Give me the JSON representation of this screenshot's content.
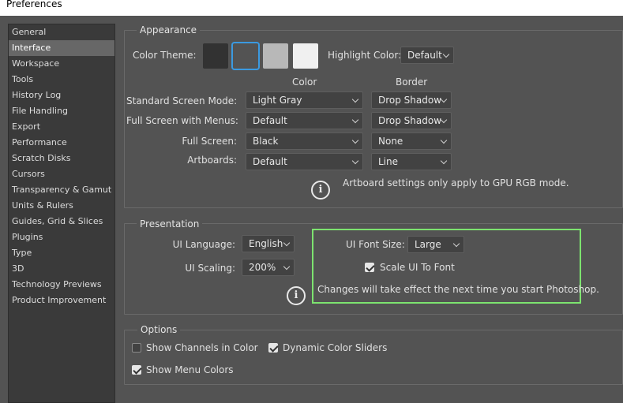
{
  "window": {
    "title": "Preferences"
  },
  "sidebar": {
    "items": [
      {
        "label": "General"
      },
      {
        "label": "Interface",
        "selected": true
      },
      {
        "label": "Workspace"
      },
      {
        "label": "Tools"
      },
      {
        "label": "History Log"
      },
      {
        "label": "File Handling"
      },
      {
        "label": "Export"
      },
      {
        "label": "Performance"
      },
      {
        "label": "Scratch Disks"
      },
      {
        "label": "Cursors"
      },
      {
        "label": "Transparency & Gamut"
      },
      {
        "label": "Units & Rulers"
      },
      {
        "label": "Guides, Grid & Slices"
      },
      {
        "label": "Plugins"
      },
      {
        "label": "Type"
      },
      {
        "label": "3D"
      },
      {
        "label": "Technology Previews"
      },
      {
        "label": "Product Improvement"
      }
    ]
  },
  "appearance": {
    "title": "Appearance",
    "color_theme_label": "Color Theme:",
    "themes": [
      {
        "name": "darkest",
        "color": "#323232"
      },
      {
        "name": "dark",
        "color": "#535353",
        "selected": true
      },
      {
        "name": "medium-gray",
        "color": "#b8b8b8"
      },
      {
        "name": "light",
        "color": "#f0f0f0"
      }
    ],
    "highlight_color_label": "Highlight Color:",
    "highlight_color_value": "Default",
    "col_color": "Color",
    "col_border": "Border",
    "rows": [
      {
        "label": "Standard Screen Mode:",
        "color": "Light Gray",
        "border": "Drop Shadow"
      },
      {
        "label": "Full Screen with Menus:",
        "color": "Default",
        "border": "Drop Shadow"
      },
      {
        "label": "Full Screen:",
        "color": "Black",
        "border": "None"
      },
      {
        "label": "Artboards:",
        "color": "Default",
        "border": "Line"
      }
    ],
    "info_text": "Artboard settings only apply to GPU RGB mode."
  },
  "presentation": {
    "title": "Presentation",
    "ui_language_label": "UI Language:",
    "ui_language_value": "English",
    "ui_scaling_label": "UI Scaling:",
    "ui_scaling_value": "200%",
    "ui_font_size_label": "UI Font Size:",
    "ui_font_size_value": "Large",
    "scale_ui_label": "Scale UI To Font",
    "scale_ui_checked": true,
    "info_text": "Changes will take effect the next time you start Photoshop."
  },
  "options": {
    "title": "Options",
    "show_channels_label": "Show Channels in Color",
    "show_channels_checked": false,
    "dynamic_sliders_label": "Dynamic Color Sliders",
    "dynamic_sliders_checked": true,
    "show_menu_colors_label": "Show Menu Colors",
    "show_menu_colors_checked": true
  },
  "colors": {
    "background": "#535353",
    "sidebar_bg": "#3a3a3a",
    "selection": "#676767",
    "accent": "#3b9ae0",
    "highlight_box": "#7de36f"
  }
}
